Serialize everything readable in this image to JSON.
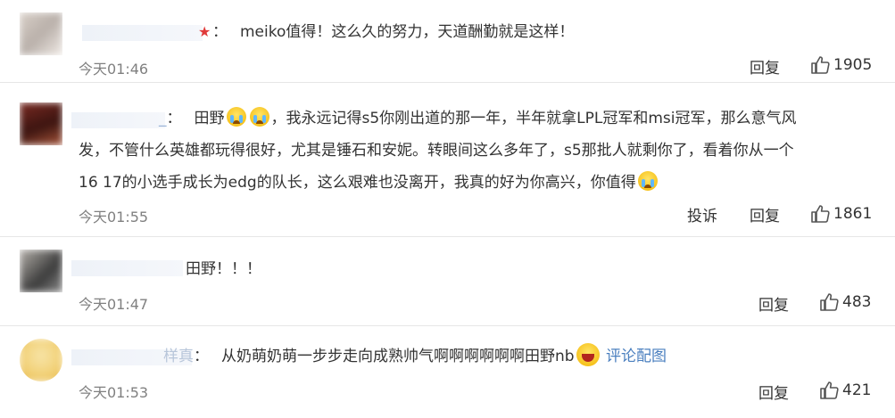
{
  "comments": [
    {
      "name_suffix": "",
      "text": "meiko值得！这么久的努力，天道酬勤就是这样！",
      "time": "今天01:46",
      "reply_label": "回复",
      "likes": "1905",
      "avatar_colors": [
        "#d9d0c8",
        "#b9b0aa",
        "#efe9e4"
      ]
    },
    {
      "name_suffix": "_",
      "text_lines": [
        [
          "田野",
          "，我永远记得s5你刚出道的那一年，半年就拿LPL冠军和msi冠军，那么意气风"
        ],
        "发，不管什么英雄都玩得很好，尤其是锤石和安妮。转眼间这么多年了，s5那批人就剩你了，看着你从一个",
        "16 17的小选手成长为edg的队长，这么艰难也没离开，我真的好为你高兴，你值得"
      ],
      "time": "今天01:55",
      "report_label": "投诉",
      "reply_label": "回复",
      "likes": "1861",
      "avatar_colors": [
        "#7a2a22",
        "#3b1410",
        "#a8553a"
      ]
    },
    {
      "name_suffix": "",
      "text": "田野！！！",
      "time": "今天01:47",
      "reply_label": "回复",
      "likes": "483",
      "avatar_colors": [
        "#8a8a8a",
        "#3c3c3c",
        "#b5b0aa"
      ]
    },
    {
      "name_suffix": "样真",
      "text": "从奶萌奶萌一步步走向成熟帅气啊啊啊啊啊啊田野nb",
      "link": "评论配图",
      "time": "今天01:53",
      "reply_label": "回复",
      "likes": "421",
      "avatar_colors": [
        "#f2d27a",
        "#e8b84a",
        "#f7e4a8"
      ]
    }
  ]
}
